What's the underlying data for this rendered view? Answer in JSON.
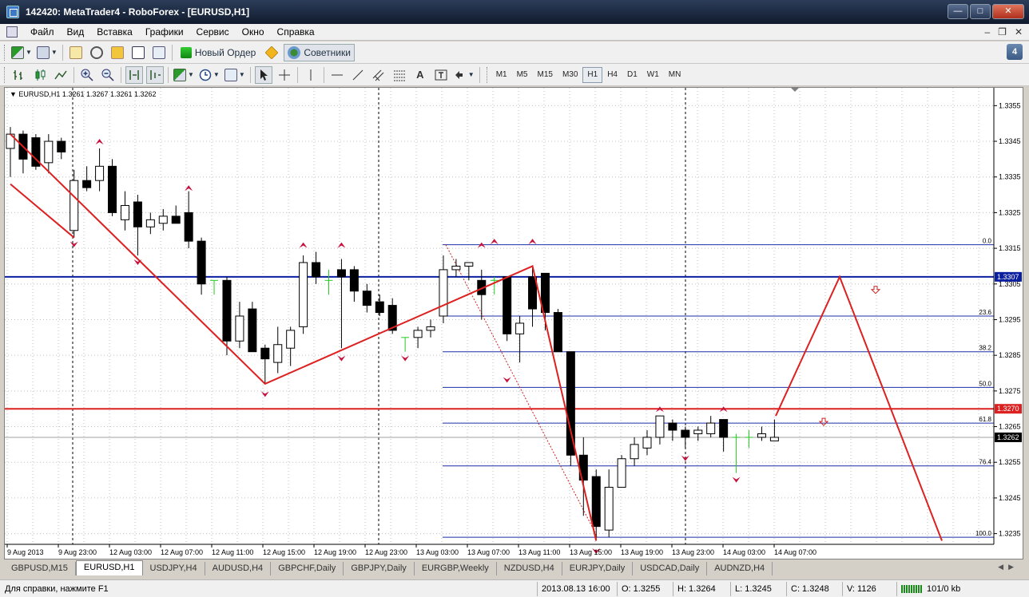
{
  "window": {
    "title": "142420: MetaTrader4 - RoboForex - [EURUSD,H1]"
  },
  "menu": [
    "Файл",
    "Вид",
    "Вставка",
    "Графики",
    "Сервис",
    "Окно",
    "Справка"
  ],
  "toolbar1": {
    "new_order": "Новый Ордер",
    "advisors": "Советники",
    "badge": "4"
  },
  "toolbar2": {
    "text_tool": "A",
    "timeframes": [
      "M1",
      "M5",
      "M15",
      "M30",
      "H1",
      "H4",
      "D1",
      "W1",
      "MN"
    ],
    "active_tf": "H1"
  },
  "chart": {
    "symbol_label": "EURUSD,H1  1.3261 1.3267 1.3261 1.3262",
    "price_axis": [
      "1.3355",
      "1.3345",
      "1.3335",
      "1.3325",
      "1.3315",
      "1.3305",
      "1.3295",
      "1.3285",
      "1.3275",
      "1.3265",
      "1.3255",
      "1.3245",
      "1.3235"
    ],
    "time_axis": [
      "9 Aug 2013",
      "9 Aug 23:00",
      "12 Aug 03:00",
      "12 Aug 07:00",
      "12 Aug 11:00",
      "12 Aug 15:00",
      "12 Aug 19:00",
      "12 Aug 23:00",
      "13 Aug 03:00",
      "13 Aug 07:00",
      "13 Aug 11:00",
      "13 Aug 15:00",
      "13 Aug 19:00",
      "13 Aug 23:00",
      "14 Aug 03:00",
      "14 Aug 07:00"
    ],
    "blue_level_label": "1.3307",
    "red_level_label": "1.3270",
    "bid_label": "1.3262",
    "fib_levels": [
      {
        "label": "0.0",
        "price": 1.3316
      },
      {
        "label": "23.6",
        "price": 1.3296
      },
      {
        "label": "38.2",
        "price": 1.3286
      },
      {
        "label": "50.0",
        "price": 1.3276
      },
      {
        "label": "61.8",
        "price": 1.3266
      },
      {
        "label": "76.4",
        "price": 1.3254
      },
      {
        "label": "100.0",
        "price": 1.3234
      }
    ],
    "colors": {
      "bull_body": "#ffffff",
      "bear_body": "#000000",
      "zigzag": "#dd2020",
      "fib": "#1c2fa8",
      "level_blue": "#0a1ea0",
      "level_red": "#dd2020",
      "arrow": "#c8103c",
      "doji_green": "#22cc22"
    }
  },
  "chart_data": {
    "type": "candlestick",
    "series": [
      {
        "ohlc": [
          [
            1.3343,
            1.3349,
            1.3335,
            1.3347
          ],
          [
            1.3347,
            1.3348,
            1.3336,
            1.334
          ],
          [
            1.3346,
            1.3347,
            1.3337,
            1.3338
          ],
          [
            1.3339,
            1.3347,
            1.3336,
            1.3345
          ],
          [
            1.3345,
            1.3346,
            1.334,
            1.3342
          ],
          [
            1.332,
            1.3337,
            1.3318,
            1.3334
          ],
          [
            1.3334,
            1.3338,
            1.3331,
            1.3332
          ],
          [
            1.3334,
            1.3343,
            1.3331,
            1.3338
          ],
          [
            1.3338,
            1.334,
            1.3324,
            1.3325
          ],
          [
            1.3323,
            1.3331,
            1.332,
            1.3327
          ],
          [
            1.3328,
            1.333,
            1.3313,
            1.3321
          ],
          [
            1.3321,
            1.3325,
            1.3319,
            1.3323
          ],
          [
            1.3322,
            1.3326,
            1.332,
            1.3324
          ],
          [
            1.3324,
            1.3327,
            1.3322,
            1.3322
          ],
          [
            1.3325,
            1.3331,
            1.3315,
            1.3317
          ],
          [
            1.3317,
            1.3318,
            1.3302,
            1.3305
          ],
          [
            1.3306,
            1.3306,
            1.3302,
            1.3306
          ],
          [
            1.3306,
            1.3307,
            1.3285,
            1.3289
          ],
          [
            1.3289,
            1.33,
            1.3287,
            1.3296
          ],
          [
            1.3298,
            1.33,
            1.3286,
            1.3286
          ],
          [
            1.3287,
            1.3288,
            1.3277,
            1.3284
          ],
          [
            1.3283,
            1.3293,
            1.328,
            1.3288
          ],
          [
            1.3287,
            1.3293,
            1.3282,
            1.3292
          ],
          [
            1.3293,
            1.3313,
            1.3291,
            1.3311
          ],
          [
            1.3311,
            1.3314,
            1.3305,
            1.3307
          ],
          [
            1.3306,
            1.3309,
            1.3302,
            1.3306
          ],
          [
            1.3309,
            1.3312,
            1.3287,
            1.3307
          ],
          [
            1.3309,
            1.331,
            1.33,
            1.3303
          ],
          [
            1.3303,
            1.3305,
            1.3297,
            1.3299
          ],
          [
            1.33,
            1.3302,
            1.3296,
            1.3297
          ],
          [
            1.3299,
            1.3301,
            1.3291,
            1.3292
          ],
          [
            1.329,
            1.329,
            1.3286,
            1.329
          ],
          [
            1.329,
            1.3293,
            1.3287,
            1.3292
          ],
          [
            1.3292,
            1.3295,
            1.329,
            1.3293
          ],
          [
            1.3296,
            1.3313,
            1.3294,
            1.3309
          ],
          [
            1.3309,
            1.3312,
            1.3307,
            1.331
          ],
          [
            1.331,
            1.3311,
            1.3306,
            1.3311
          ],
          [
            1.3306,
            1.3309,
            1.3295,
            1.3302
          ],
          [
            1.3306,
            1.3307,
            1.3302,
            1.3306
          ],
          [
            1.3307,
            1.3307,
            1.3289,
            1.3291
          ],
          [
            1.3291,
            1.3296,
            1.3283,
            1.3294
          ],
          [
            1.3307,
            1.331,
            1.3293,
            1.3298
          ],
          [
            1.3308,
            1.3308,
            1.3292,
            1.3297
          ],
          [
            1.3297,
            1.3298,
            1.3286,
            1.3286
          ],
          [
            1.3286,
            1.3286,
            1.3254,
            1.3257
          ],
          [
            1.3257,
            1.3262,
            1.324,
            1.325
          ],
          [
            1.3251,
            1.3253,
            1.3233,
            1.3237
          ],
          [
            1.3236,
            1.3253,
            1.3234,
            1.3248
          ],
          [
            1.3248,
            1.3257,
            1.3248,
            1.3256
          ],
          [
            1.3256,
            1.3262,
            1.3254,
            1.326
          ],
          [
            1.3259,
            1.3264,
            1.3257,
            1.3262
          ],
          [
            1.3262,
            1.3268,
            1.326,
            1.3268
          ],
          [
            1.3266,
            1.3267,
            1.3261,
            1.3264
          ],
          [
            1.3264,
            1.3265,
            1.3259,
            1.3262
          ],
          [
            1.3263,
            1.3265,
            1.3261,
            1.3264
          ],
          [
            1.3263,
            1.3268,
            1.3262,
            1.3266
          ],
          [
            1.3267,
            1.3267,
            1.3258,
            1.3262
          ],
          [
            1.3262,
            1.3263,
            1.3252,
            1.3262
          ],
          [
            1.3262,
            1.3264,
            1.3259,
            1.3262
          ],
          [
            1.3262,
            1.3265,
            1.3261,
            1.3263
          ],
          [
            1.3261,
            1.3267,
            1.3261,
            1.3262
          ]
        ]
      }
    ],
    "y_range": [
      1.3232,
      1.336
    ]
  },
  "tabs": [
    "GBPUSD,M15",
    "EURUSD,H1",
    "USDJPY,H4",
    "AUDUSD,H4",
    "GBPCHF,Daily",
    "GBPJPY,Daily",
    "EURGBP,Weekly",
    "NZDUSD,H4",
    "EURJPY,Daily",
    "USDCAD,Daily",
    "AUDNZD,H4"
  ],
  "active_tab": "EURUSD,H1",
  "status": {
    "help": "Для справки, нажмите F1",
    "datetime": "2013.08.13 16:00",
    "open": "O: 1.3255",
    "high": "H: 1.3264",
    "low": "L: 1.3245",
    "close": "C: 1.3248",
    "volume": "V: 1126",
    "traffic": "101/0 kb"
  }
}
